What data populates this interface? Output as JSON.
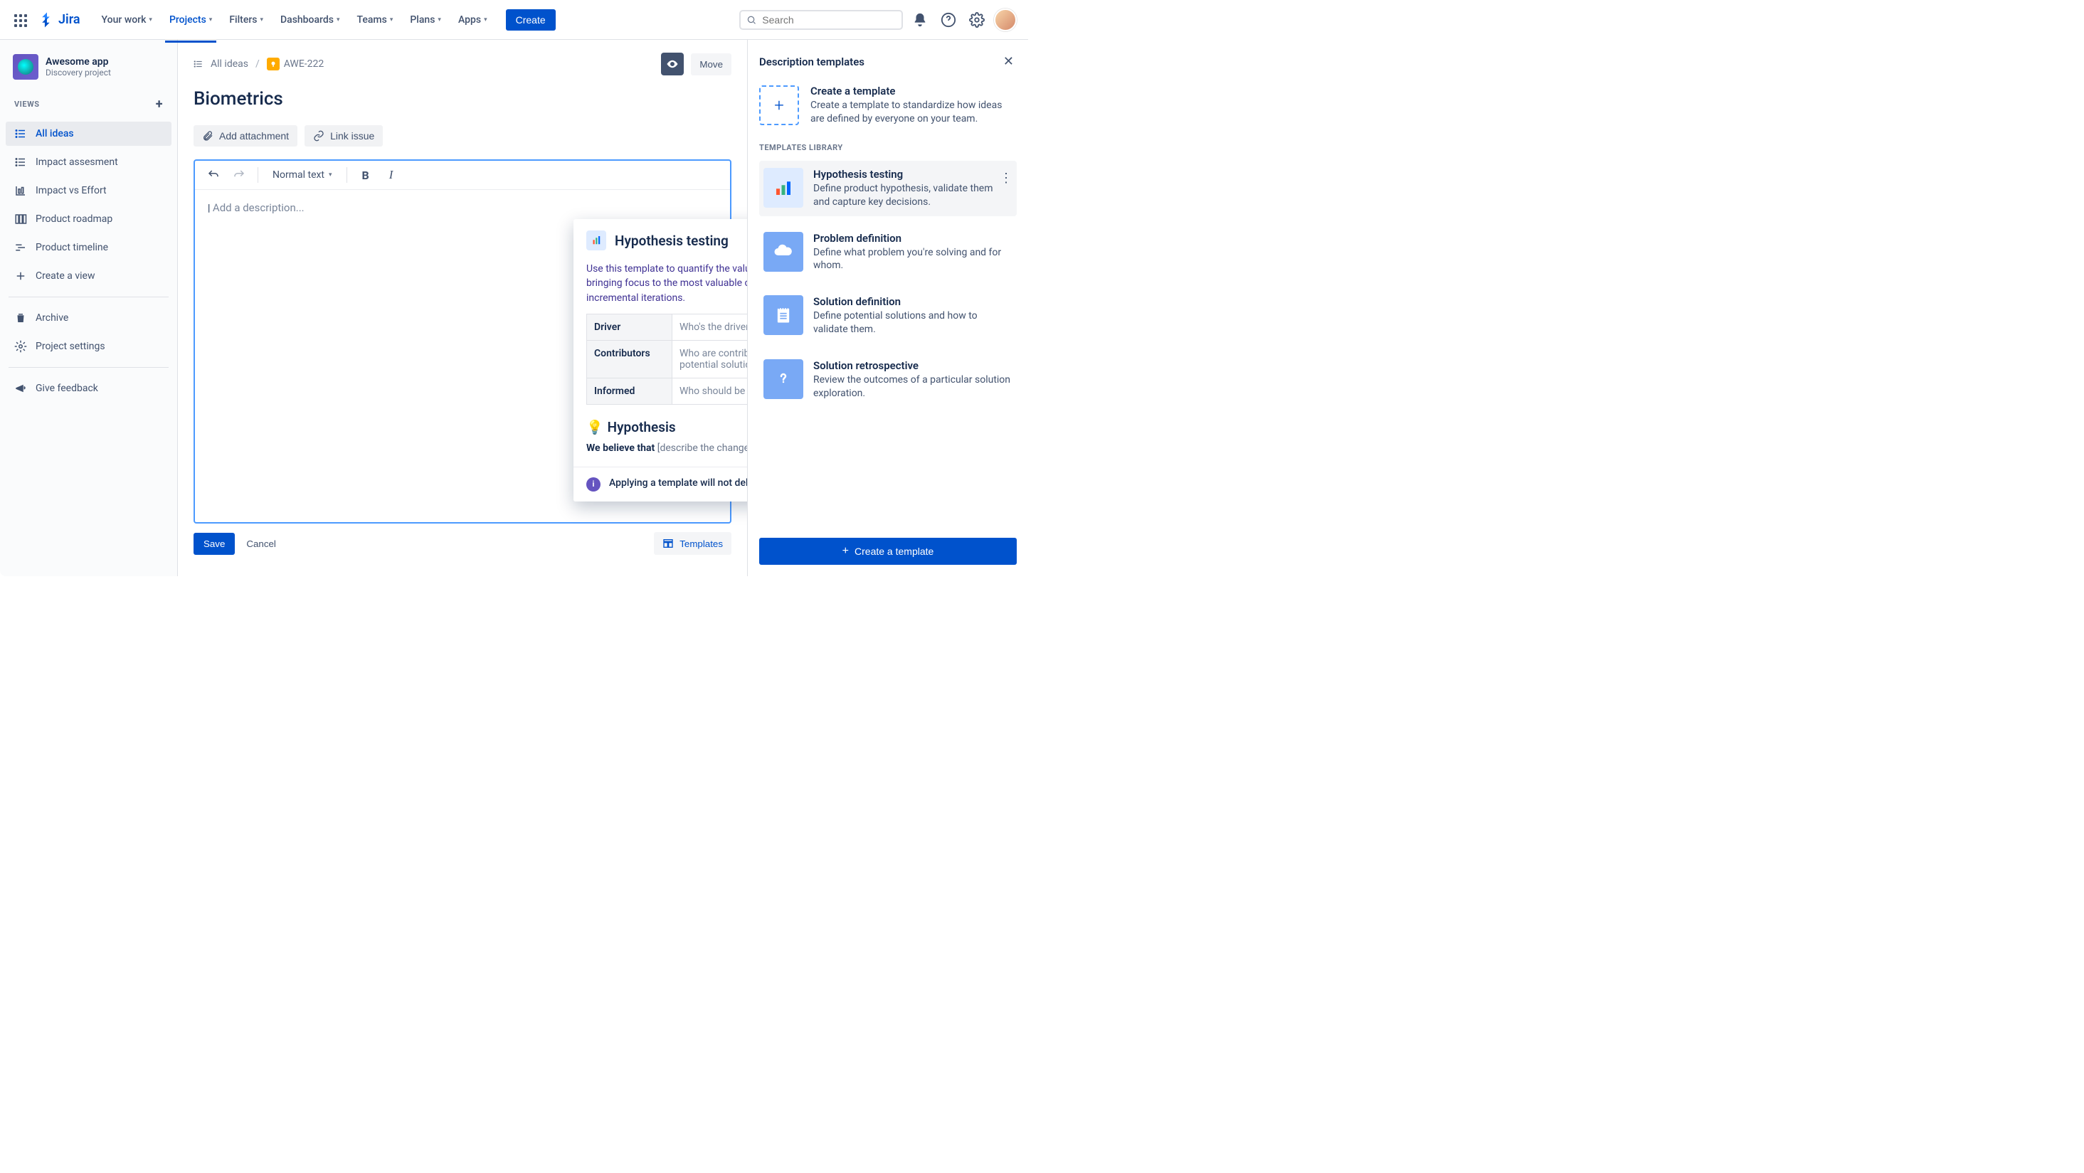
{
  "nav": {
    "logo": "Jira",
    "items": [
      "Your work",
      "Projects",
      "Filters",
      "Dashboards",
      "Teams",
      "Plans",
      "Apps"
    ],
    "create": "Create",
    "search_placeholder": "Search"
  },
  "project": {
    "name": "Awesome app",
    "type": "Discovery project"
  },
  "sidebar": {
    "section_views": "VIEWS",
    "views": [
      {
        "label": "All ideas",
        "icon": "list"
      },
      {
        "label": "Impact assesment",
        "icon": "list"
      },
      {
        "label": "Impact vs Effort",
        "icon": "chart"
      },
      {
        "label": "Product roadmap",
        "icon": "board"
      },
      {
        "label": "Product timeline",
        "icon": "timeline"
      }
    ],
    "create_view": "Create a view",
    "archive": "Archive",
    "settings": "Project settings",
    "feedback": "Give feedback"
  },
  "breadcrumb": {
    "root": "All ideas",
    "key": "AWE-222",
    "move": "Move"
  },
  "idea": {
    "title": "Biometrics",
    "attach": "Add attachment",
    "link": "Link issue",
    "normal_text": "Normal text",
    "placeholder": "Add a description...",
    "save": "Save",
    "cancel": "Cancel",
    "templates_btn": "Templates"
  },
  "preview": {
    "title": "Hypothesis testing",
    "intro": "Use this template to quantify the value delivered by new solutions while bringing focus to the most valuable changes, and delivering incremental iterations.",
    "rows": [
      {
        "label": "Driver",
        "hint": "Who's the driver for this exploration?"
      },
      {
        "label": "Contributors",
        "hint": "Who are contributors helping define and validate potential solutions?"
      },
      {
        "label": "Informed",
        "hint": "Who should be informed of the findings?"
      }
    ],
    "h2_emoji": "💡",
    "h2": "Hypothesis",
    "believe_lead": "We believe that",
    "believe_rest": "[describe the change we are making]",
    "note": "Applying a template will not delete your idea's description."
  },
  "rpanel": {
    "title": "Description templates",
    "new_title": "Create a template",
    "new_sub": "Create a template to standardize how ideas are defined by everyone on your team.",
    "lib_heading": "TEMPLATES LIBRARY",
    "templates": [
      {
        "title": "Hypothesis testing",
        "sub": "Define product hypothesis, validate them and capture key decisions.",
        "icon": "bars"
      },
      {
        "title": "Problem definition",
        "sub": "Define what problem you're solving and for whom.",
        "icon": "cloud"
      },
      {
        "title": "Solution definition",
        "sub": "Define potential solutions and how to validate them.",
        "icon": "notepad"
      },
      {
        "title": "Solution retrospective",
        "sub": "Review the outcomes of a particular solution exploration.",
        "icon": "question"
      }
    ],
    "create_btn": "Create a template"
  }
}
